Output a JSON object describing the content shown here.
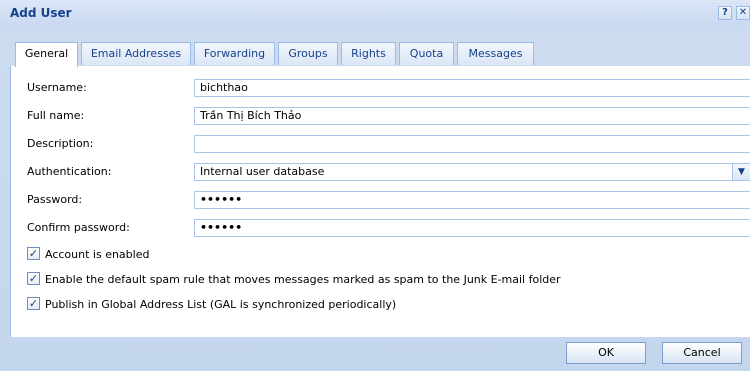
{
  "window": {
    "title": "Add User",
    "help_label": "?",
    "close_label": "✕"
  },
  "tabs": [
    {
      "label": "General",
      "active": true
    },
    {
      "label": "Email Addresses",
      "active": false
    },
    {
      "label": "Forwarding",
      "active": false
    },
    {
      "label": "Groups",
      "active": false
    },
    {
      "label": "Rights",
      "active": false
    },
    {
      "label": "Quota",
      "active": false
    },
    {
      "label": "Messages",
      "active": false
    }
  ],
  "form": {
    "username": {
      "label": "Username:",
      "value": "bichthao"
    },
    "full_name": {
      "label": "Full name:",
      "value": "Trần Thị Bích Thảo"
    },
    "description": {
      "label": "Description:",
      "value": ""
    },
    "authentication": {
      "label": "Authentication:",
      "value": "Internal user database"
    },
    "password": {
      "label": "Password:",
      "value": "••••••"
    },
    "confirm_password": {
      "label": "Confirm password:",
      "value": "••••••"
    }
  },
  "checkboxes": [
    {
      "label": "Account is enabled",
      "checked": true
    },
    {
      "label": "Enable the default spam rule that moves messages marked as spam to the Junk E-mail folder",
      "checked": true
    },
    {
      "label": "Publish in Global Address List (GAL is synchronized periodically)",
      "checked": true
    }
  ],
  "buttons": {
    "ok": "OK",
    "cancel": "Cancel"
  },
  "colors": {
    "accent": "#15428b",
    "border": "#99bbe8",
    "background": "#dfe8f6"
  }
}
